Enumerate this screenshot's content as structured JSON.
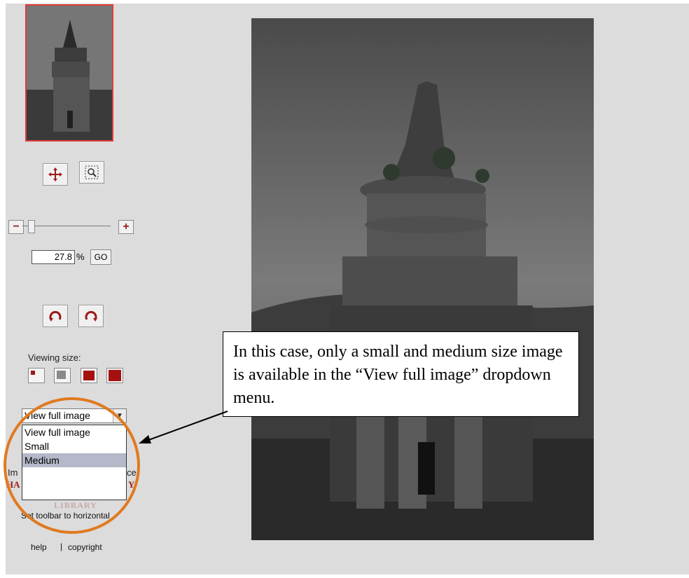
{
  "zoom": {
    "minus_label": "−",
    "plus_label": "+",
    "percent_value": "27.8",
    "percent_sign": "%",
    "go_label": "GO"
  },
  "viewing_size": {
    "label": "Viewing size:"
  },
  "view_select": {
    "selected": "View full image",
    "options": [
      "View full image",
      "Small",
      "Medium"
    ],
    "highlighted_index": 2
  },
  "partial_text": {
    "left": "Im",
    "right": "ce",
    "logo_fragment": "HA",
    "logo_fragment_right": "Y",
    "library": "LIBRARY"
  },
  "footer": {
    "toolbar_link": "Set toolbar to horizontal",
    "help_link": "help",
    "separator": "|",
    "copyright_link": "copyright"
  },
  "callout": {
    "text": "In this case, only a small and medium size image is available in the “View full image” dropdown menu."
  },
  "colors": {
    "accent": "#9b1b1b",
    "highlight_circle": "#e07a20",
    "thumb_border": "#e23a3a"
  },
  "icons": [
    "pan-icon",
    "zoom-region-icon",
    "rotate-left-icon",
    "rotate-right-icon"
  ]
}
